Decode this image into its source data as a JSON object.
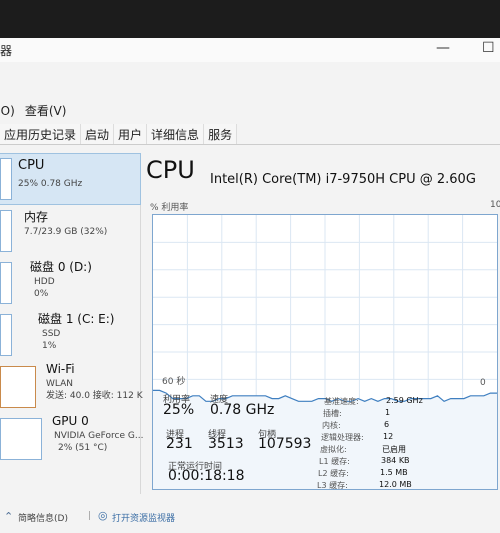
{
  "window": {
    "title": "器",
    "min": "—",
    "max": "☐"
  },
  "menu": {
    "options": "选项(O)",
    "view": "查看(V)"
  },
  "tabs": [
    {
      "label": "应用历史记录"
    },
    {
      "label": "启动"
    },
    {
      "label": "用户"
    },
    {
      "label": "详细信息"
    },
    {
      "label": "服务"
    }
  ],
  "sidebar": [
    {
      "name": "CPU",
      "sub1": "25% 0.78 GHz",
      "sub2": ""
    },
    {
      "name": "内存",
      "sub1": "7.7/23.9 GB (32%)",
      "sub2": ""
    },
    {
      "name": "磁盘 0 (D:)",
      "sub1": "HDD",
      "sub2": "0%"
    },
    {
      "name": "磁盘 1 (C: E:)",
      "sub1": "SSD",
      "sub2": "1%"
    },
    {
      "name": "Wi-Fi",
      "sub1": "WLAN",
      "sub2": "发送: 40.0 接收: 112 K"
    },
    {
      "name": "GPU 0",
      "sub1": "NVIDIA GeForce G...",
      "sub2": "2% (51 °C)"
    }
  ],
  "main": {
    "title": "CPU",
    "model": "Intel(R) Core(TM) i7-9750H CPU @ 2.60G",
    "graph_label": "% 利用率",
    "graph_max": "10",
    "time_label": "60 秒",
    "time_end": "0"
  },
  "stats": {
    "util_label": "利用率",
    "util": "25%",
    "speed_label": "速度",
    "speed": "0.78 GHz",
    "proc_label": "进程",
    "proc": "231",
    "thread_label": "线程",
    "thread": "3513",
    "handle_label": "句柄",
    "handle": "107593",
    "uptime_label": "正常运行时间",
    "uptime": "0:00:18:18"
  },
  "details": [
    {
      "k": "基准速度:",
      "v": "2.59 GHz"
    },
    {
      "k": "插槽:",
      "v": "1"
    },
    {
      "k": "内核:",
      "v": "6"
    },
    {
      "k": "逻辑处理器:",
      "v": "12"
    },
    {
      "k": "虚拟化:",
      "v": "已启用"
    },
    {
      "k": "L1 缓存:",
      "v": "384 KB"
    },
    {
      "k": "L2 缓存:",
      "v": "1.5 MB"
    },
    {
      "k": "L3 缓存:",
      "v": "12.0 MB"
    }
  ],
  "footer": {
    "brief": "简略信息(D)",
    "open_monitor": "打开资源监视器"
  },
  "cpu_history": [
    36,
    36,
    35,
    33,
    33,
    33,
    34,
    34,
    32,
    32,
    33,
    33,
    34,
    34,
    34,
    34,
    34,
    34,
    33,
    33,
    34,
    33,
    32,
    32,
    32,
    33,
    33,
    32,
    33,
    32,
    32,
    33,
    32,
    33,
    32,
    33,
    33,
    32,
    32,
    33,
    33,
    33,
    33,
    34,
    32,
    33,
    33,
    33,
    34,
    34,
    34,
    35,
    35
  ]
}
